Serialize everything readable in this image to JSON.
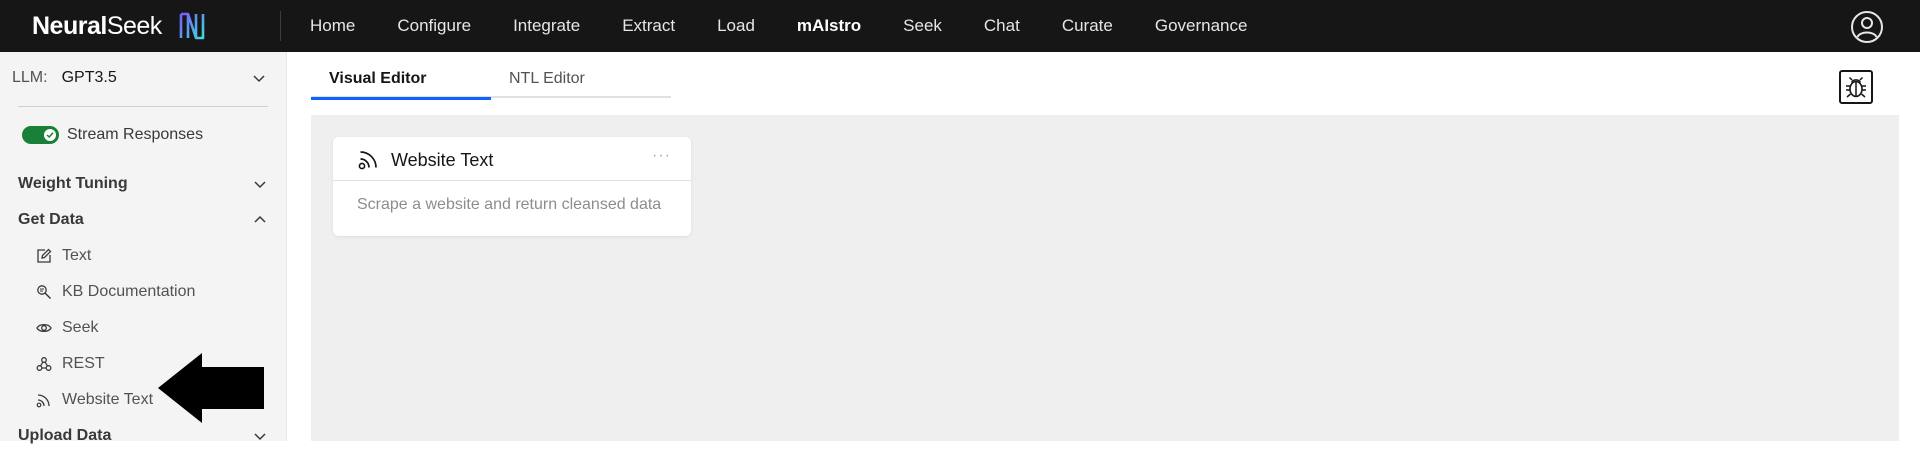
{
  "app": {
    "brand_first": "Neural",
    "brand_second": "Seek"
  },
  "nav": {
    "items": [
      "Home",
      "Configure",
      "Integrate",
      "Extract",
      "Load",
      "mAIstro",
      "Seek",
      "Chat",
      "Curate",
      "Governance"
    ]
  },
  "sidebar": {
    "llm_label": "LLM:",
    "llm_value": "GPT3.5",
    "stream_toggle": {
      "label": "Stream Responses",
      "on": true
    },
    "sections": {
      "weight_tuning": "Weight Tuning",
      "get_data": "Get Data",
      "upload_data": "Upload Data"
    },
    "get_data_items": [
      {
        "label": "Text",
        "icon": "edit-icon"
      },
      {
        "label": "KB Documentation",
        "icon": "search-document-icon"
      },
      {
        "label": "Seek",
        "icon": "eye-icon"
      },
      {
        "label": "REST",
        "icon": "webhook-icon"
      },
      {
        "label": "Website Text",
        "icon": "rss-icon"
      }
    ]
  },
  "editor": {
    "tabs": [
      "Visual Editor",
      "NTL Editor"
    ],
    "active_tab": "Visual Editor"
  },
  "card": {
    "title": "Website Text",
    "menu": "···",
    "description": "Scrape a website and return cleansed data"
  },
  "colors": {
    "topbar": "#161616",
    "toggle_on": "#198038",
    "tab_active_underline": "#0f62fe",
    "canvas": "#efefef"
  }
}
